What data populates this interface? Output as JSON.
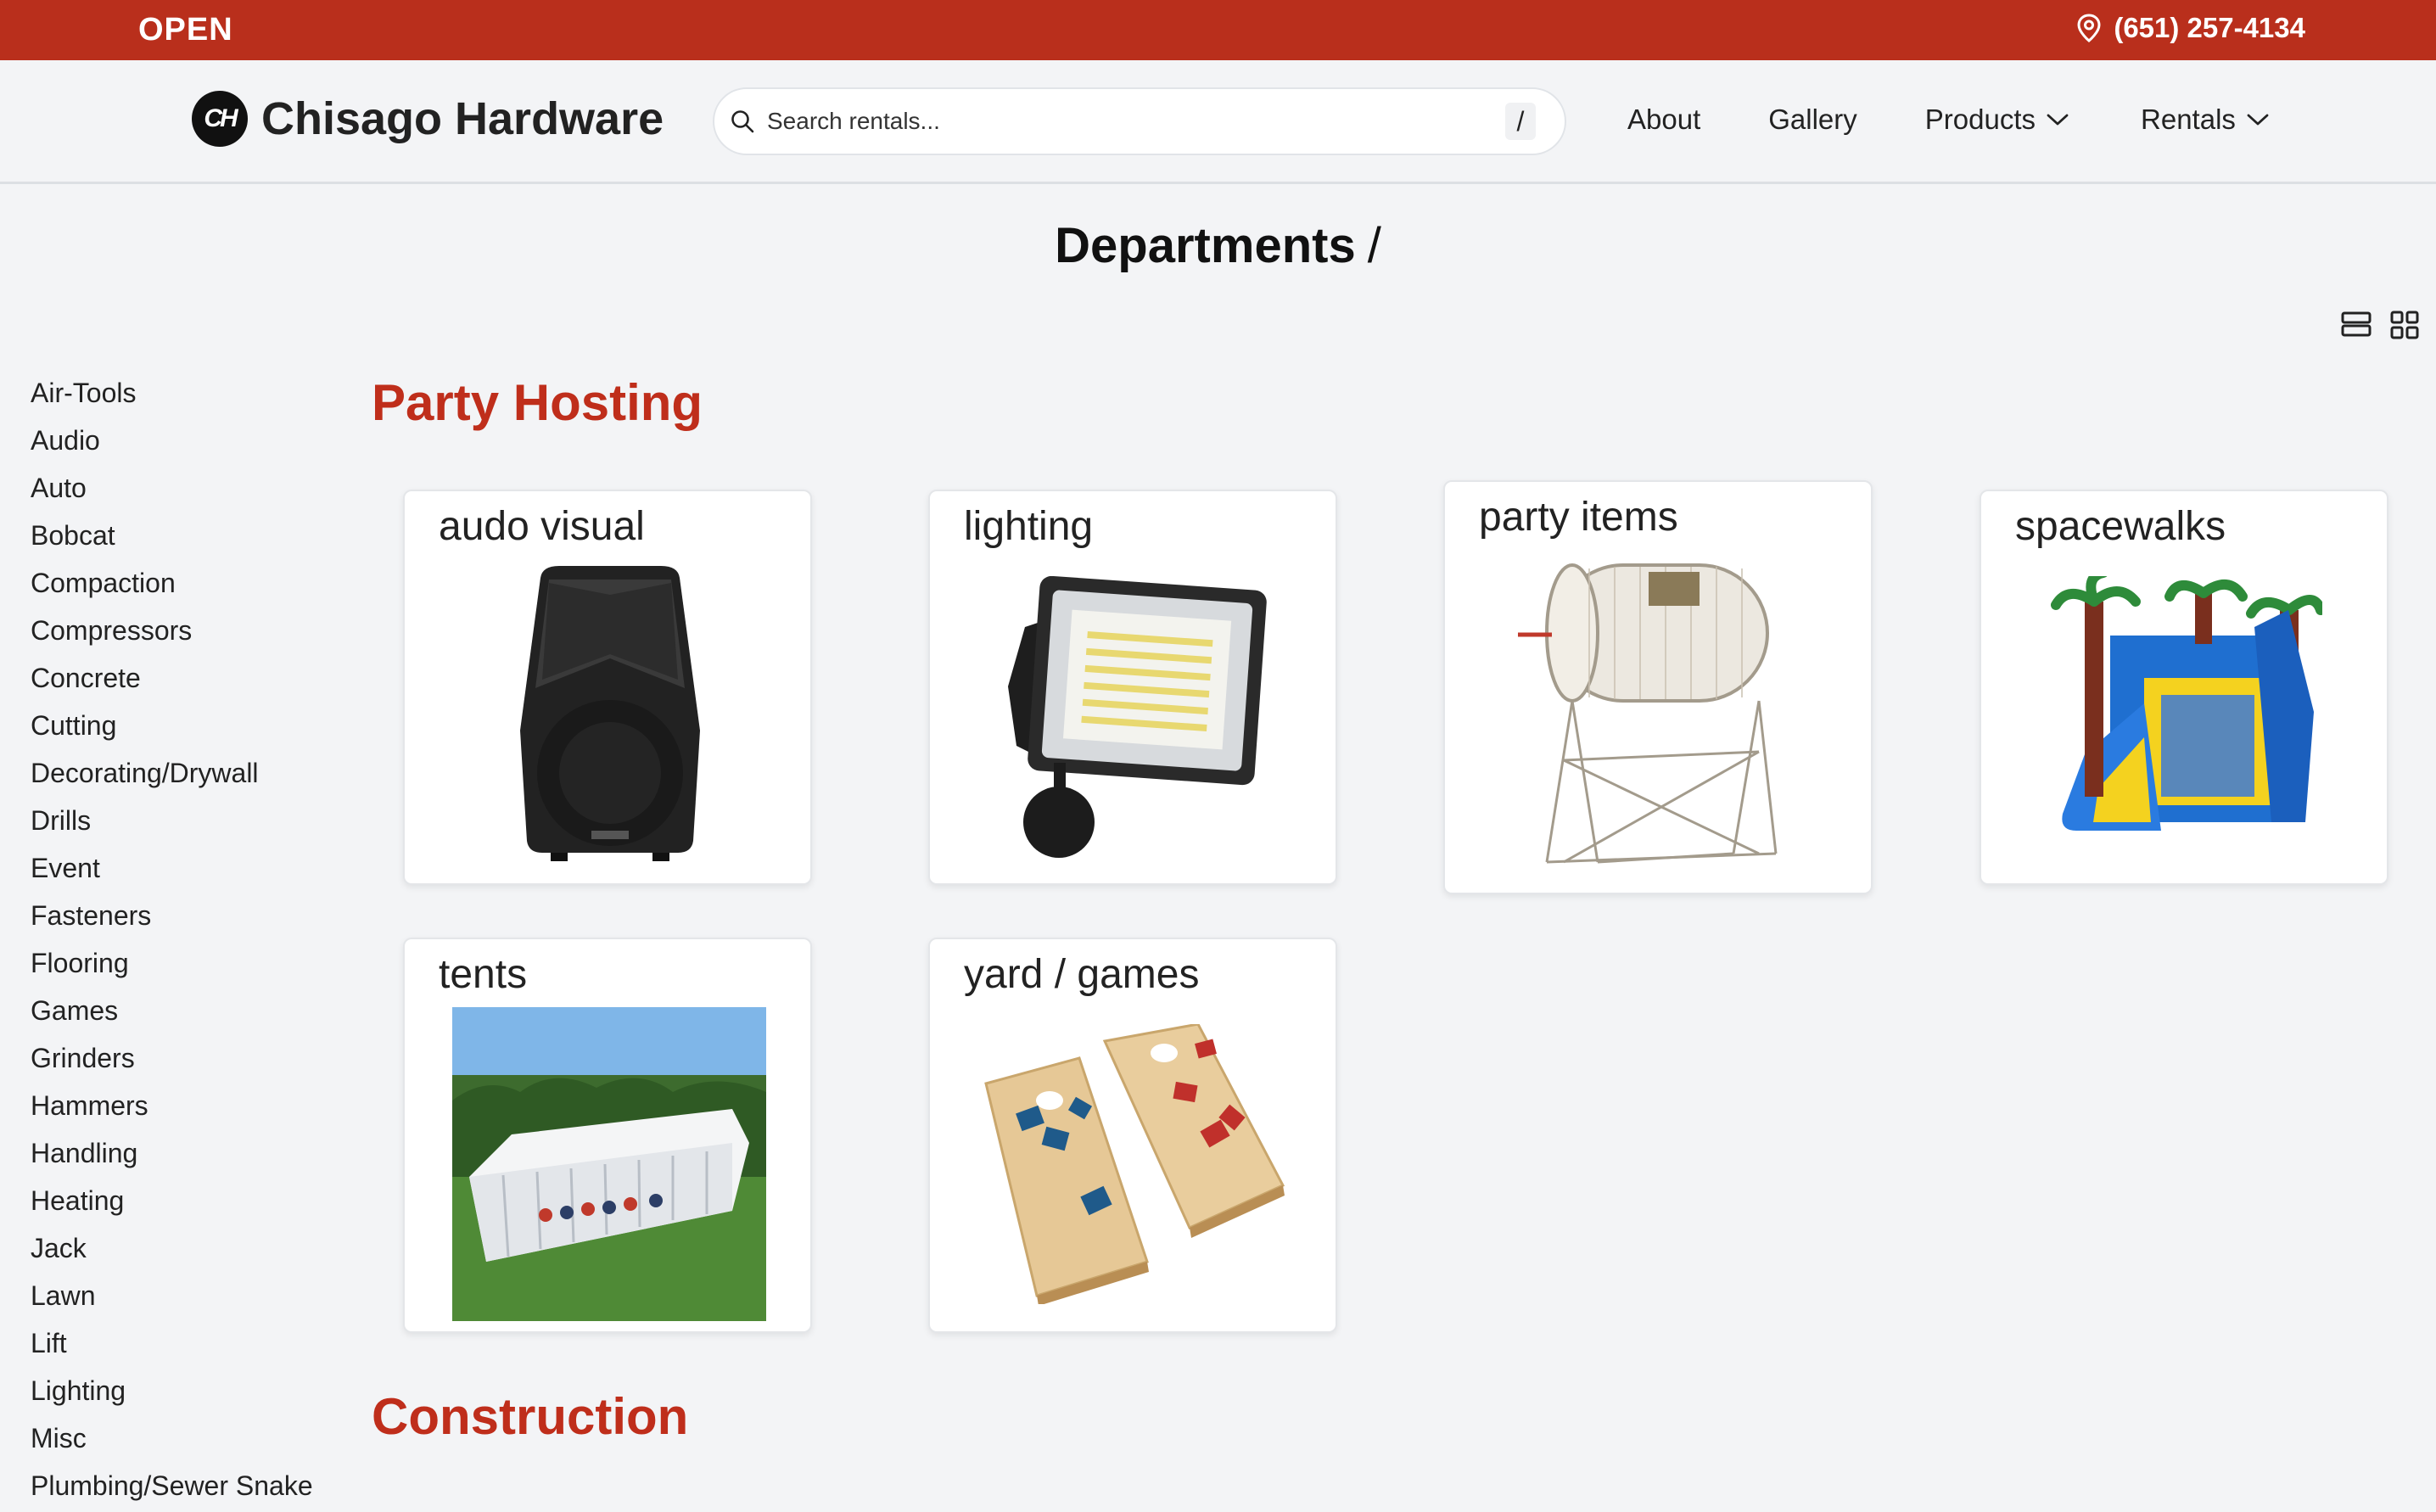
{
  "topbar": {
    "status": "OPEN",
    "phone": "(651) 257-4134"
  },
  "brand": {
    "logo_text": "CH",
    "name": "Chisago Hardware"
  },
  "search": {
    "placeholder": "Search rentals...",
    "shortcut": "/"
  },
  "nav": {
    "about": "About",
    "gallery": "Gallery",
    "products": "Products",
    "rentals": "Rentals"
  },
  "page": {
    "title": "Departments",
    "separator": "/"
  },
  "sidebar": {
    "categories": [
      "Air-Tools",
      "Audio",
      "Auto",
      "Bobcat",
      "Compaction",
      "Compressors",
      "Concrete",
      "Cutting",
      "Decorating/Drywall",
      "Drills",
      "Event",
      "Fasteners",
      "Flooring",
      "Games",
      "Grinders",
      "Hammers",
      "Handling",
      "Heating",
      "Jack",
      "Lawn",
      "Lift",
      "Lighting",
      "Misc",
      "Plumbing/Sewer Snake"
    ]
  },
  "sections": [
    {
      "title": "Party Hosting",
      "cards": [
        {
          "label": "audo visual",
          "icon": "speaker-image"
        },
        {
          "label": "lighting",
          "icon": "floodlight-image"
        },
        {
          "label": "party items",
          "icon": "raffle-drum-image"
        },
        {
          "label": "spacewalks",
          "icon": "bounce-house-image"
        },
        {
          "label": "tents",
          "icon": "party-tent-photo"
        },
        {
          "label": "yard / games",
          "icon": "cornhole-boards-image"
        }
      ]
    },
    {
      "title": "Construction",
      "cards": []
    }
  ],
  "colors": {
    "brand_red": "#b92f1c",
    "section_red": "#bf2e1b",
    "background": "#f3f4f6"
  }
}
